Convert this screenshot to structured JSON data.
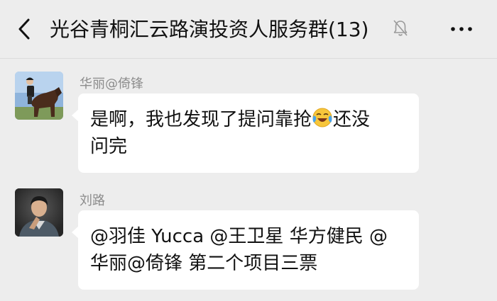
{
  "header": {
    "title": "光谷青桐汇云路演投资人服务群(13)"
  },
  "messages": [
    {
      "sender": "华丽@倚锋",
      "avatar_icon": "horse-rider-avatar",
      "text_before_emoji": "是啊，我也发现了提问靠抢",
      "emoji_icon": "crying-laughing-emoji",
      "text_after_emoji": "还没",
      "text_line2": "问完"
    },
    {
      "sender": "刘路",
      "avatar_icon": "man-portrait-avatar",
      "text_line1": "@羽佳 Yucca @王卫星 华方健民 @",
      "text_line2": "华丽@倚锋  第二个项目三票"
    }
  ],
  "colors": {
    "background": "#ededed",
    "bubble": "#ffffff",
    "sender_name": "#8c8c8c"
  }
}
